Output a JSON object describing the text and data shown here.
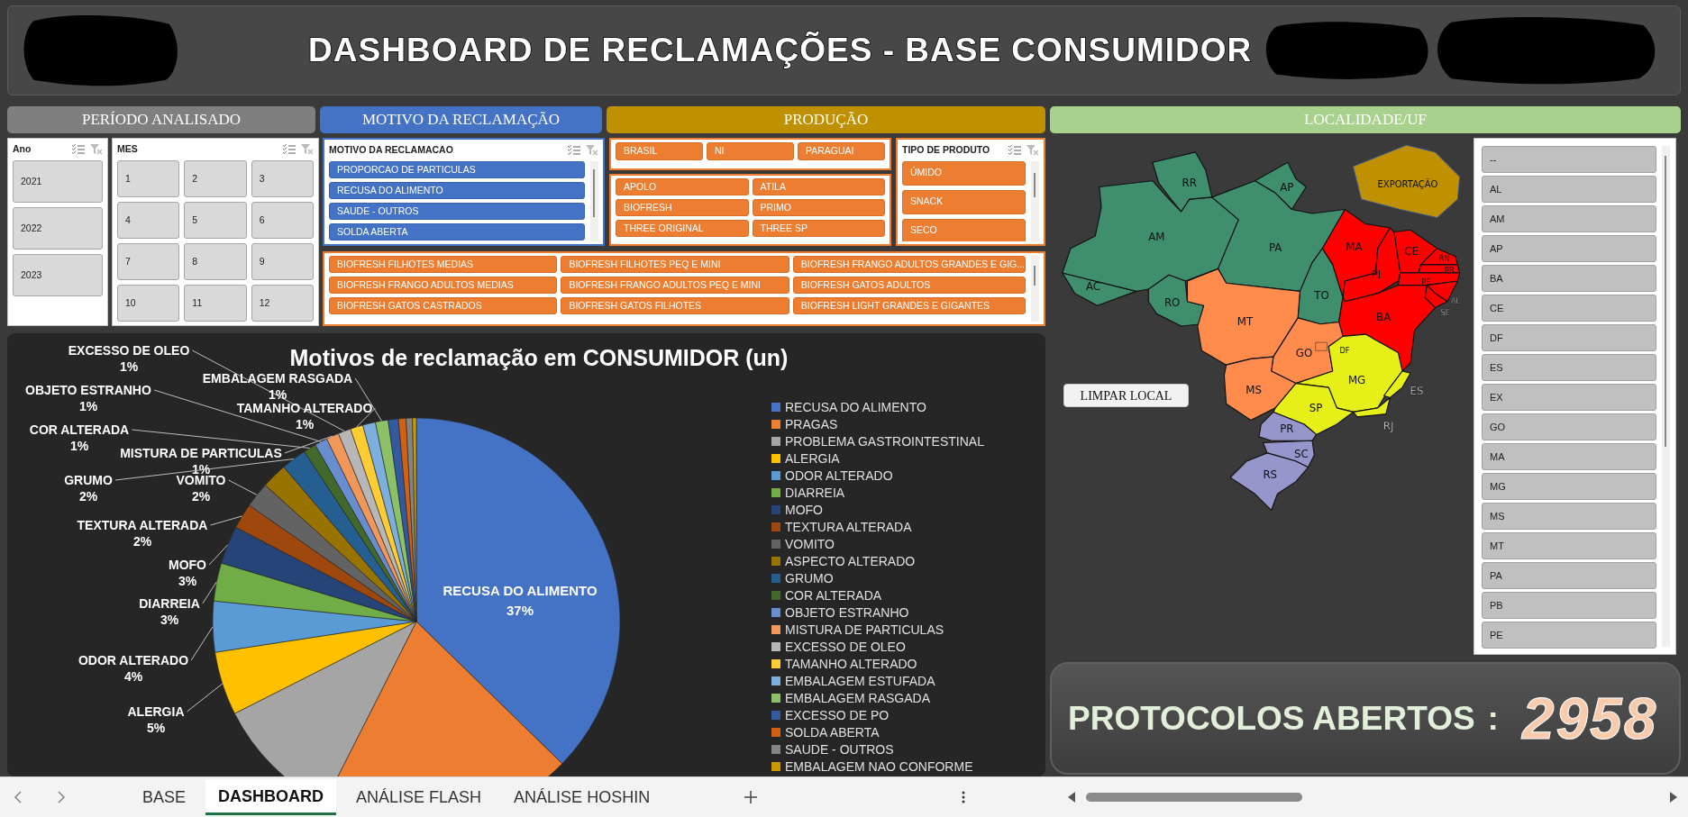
{
  "title": "DASHBOARD DE RECLAMAÇÕES - BASE CONSUMIDOR",
  "sections": [
    {
      "label": "PERÍODO ANALISADO",
      "color": "#7f7f7f"
    },
    {
      "label": "MOTIVO DA RECLAMAÇÃO",
      "color": "#4472c4"
    },
    {
      "label": "PRODUÇÃO",
      "color": "#bf9000"
    },
    {
      "label": "LOCALIDADE/UF",
      "color": "#a9d18e"
    }
  ],
  "slicers": {
    "year": {
      "title": "Ano",
      "items": [
        {
          "label": "2021",
          "selected": true
        },
        {
          "label": "2022",
          "selected": true
        },
        {
          "label": "2023",
          "selected": true
        }
      ]
    },
    "month": {
      "title": "MES",
      "items": [
        {
          "label": "1",
          "selected": true
        },
        {
          "label": "2",
          "selected": true
        },
        {
          "label": "3",
          "selected": true
        },
        {
          "label": "4",
          "selected": true
        },
        {
          "label": "5",
          "selected": true
        },
        {
          "label": "6",
          "selected": true
        },
        {
          "label": "7",
          "selected": true
        },
        {
          "label": "8",
          "selected": true
        },
        {
          "label": "9",
          "selected": true
        },
        {
          "label": "10",
          "selected": true
        },
        {
          "label": "11",
          "selected": true
        },
        {
          "label": "12",
          "selected": true
        }
      ]
    },
    "reason": {
      "title": "MOTIVO DA RECLAMACAO",
      "items": [
        {
          "label": "PROPORCAO DE PARTICULAS",
          "selected": true
        },
        {
          "label": "RECUSA DO ALIMENTO",
          "selected": true
        },
        {
          "label": "SAUDE - OUTROS",
          "selected": true
        },
        {
          "label": "SOLDA ABERTA",
          "selected": true
        }
      ]
    },
    "origin": {
      "items": [
        {
          "label": "BRASIL",
          "selected": true
        },
        {
          "label": "NI",
          "selected": true
        },
        {
          "label": "PARAGUAI",
          "selected": true
        }
      ]
    },
    "brand": {
      "items": [
        {
          "label": "APOLO",
          "selected": true
        },
        {
          "label": "ATILA",
          "selected": true
        },
        {
          "label": "BIOFRESH",
          "selected": true
        },
        {
          "label": "PRIMO",
          "selected": true
        },
        {
          "label": "THREE ORIGINAL",
          "selected": true
        },
        {
          "label": "THREE SP",
          "selected": true
        }
      ]
    },
    "product_type": {
      "title": "TIPO DE PRODUTO",
      "items": [
        {
          "label": "ÚMIDO",
          "selected": true
        },
        {
          "label": "SNACK",
          "selected": true
        },
        {
          "label": "SECO",
          "selected": true
        }
      ]
    },
    "product": {
      "items": [
        {
          "label": "BIOFRESH FILHOTES MEDIAS",
          "selected": true
        },
        {
          "label": "BIOFRESH FILHOTES PEQ E MINI",
          "selected": true
        },
        {
          "label": "BIOFRESH FRANGO ADULTOS GRANDES E GIG...",
          "selected": true
        },
        {
          "label": "BIOFRESH FRANGO ADULTOS MEDIAS",
          "selected": true
        },
        {
          "label": "BIOFRESH FRANGO ADULTOS PEQ E MINI",
          "selected": true
        },
        {
          "label": "BIOFRESH GATOS ADULTOS",
          "selected": true
        },
        {
          "label": "BIOFRESH GATOS CASTRADOS",
          "selected": true
        },
        {
          "label": "BIOFRESH GATOS FILHOTES",
          "selected": true
        },
        {
          "label": "BIOFRESH LIGHT GRANDES E GIGANTES",
          "selected": true
        }
      ]
    }
  },
  "chart": {
    "chart_data": {
      "type": "pie",
      "title": "Motivos de reclamação em CONSUMIDOR (un)",
      "categories": [
        "RECUSA DO ALIMENTO",
        "PRAGAS",
        "PROBLEMA GASTROINTESTINAL",
        "ALERGIA",
        "ODOR ALTERADO",
        "DIARREIA",
        "MOFO",
        "TEXTURA ALTERADA",
        "VOMITO",
        "ASPECTO ALTERADO",
        "GRUMO",
        "COR ALTERADA",
        "OBJETO ESTRANHO",
        "MISTURA DE PARTICULAS",
        "EXCESSO DE OLEO",
        "TAMANHO ALTERADO",
        "EMBALAGEM ESTUFADA",
        "EMBALAGEM RASGADA",
        "EXCESSO DE PO",
        "SOLDA ABERTA",
        "SAUDE - OUTROS",
        "EMBALAGEM NAO CONFORME"
      ],
      "values": [
        0.37,
        0.2,
        0.1,
        0.05,
        0.04,
        0.03,
        0.03,
        0.02,
        0.02,
        0.02,
        0.02,
        0.01,
        0.01,
        0.01,
        0.01,
        0.01,
        0.01,
        0.01,
        0.008,
        0.006,
        0.005,
        0.003
      ],
      "colors": [
        "#4472c4",
        "#ed7d31",
        "#a5a5a5",
        "#ffc000",
        "#5b9bd5",
        "#70ad47",
        "#264478",
        "#9e480e",
        "#636363",
        "#997300",
        "#255e91",
        "#43682b",
        "#698ed0",
        "#f1975a",
        "#b7b7b7",
        "#ffcd33",
        "#7cafdd",
        "#8cc168",
        "#335aa1",
        "#d26012",
        "#848484",
        "#cc9a00"
      ],
      "legend": "right"
    },
    "slice_labels": [
      {
        "text": "EXCESSO DE OLEO",
        "value": "1%"
      },
      {
        "text": "EMBALAGEM RASGADA",
        "value": "1%"
      },
      {
        "text": "OBJETO ESTRANHO",
        "value": "1%"
      },
      {
        "text": "TAMANHO ALTERADO",
        "value": "1%"
      },
      {
        "text": "COR ALTERADA",
        "value": "1%"
      },
      {
        "text": "MISTURA DE PARTICULAS",
        "value": "1%"
      },
      {
        "text": "GRUMO",
        "value": "2%"
      },
      {
        "text": "VOMITO",
        "value": "2%"
      },
      {
        "text": "TEXTURA ALTERADA",
        "value": "2%"
      },
      {
        "text": "MOFO",
        "value": "3%"
      },
      {
        "text": "DIARREIA",
        "value": "3%"
      },
      {
        "text": "RECUSA DO ALIMENTO",
        "value": "37%"
      },
      {
        "text": "ODOR ALTERADO",
        "value": "4%"
      },
      {
        "text": "ALERGIA",
        "value": "5%"
      }
    ]
  },
  "map": {
    "states": [
      {
        "label": "AC",
        "color": "#3f8f6f"
      },
      {
        "label": "AM",
        "color": "#3f8f6f"
      },
      {
        "label": "RR",
        "color": "#3f8f6f"
      },
      {
        "label": "AP",
        "color": "#3f8f6f"
      },
      {
        "label": "PA",
        "color": "#3f8f6f"
      },
      {
        "label": "RO",
        "color": "#3f8f6f"
      },
      {
        "label": "TO",
        "color": "#3f8f6f"
      },
      {
        "label": "MA",
        "color": "#ff0000"
      },
      {
        "label": "PI",
        "color": "#ff0000"
      },
      {
        "label": "CE",
        "color": "#ff0000"
      },
      {
        "label": "RN",
        "color": "#ff0000"
      },
      {
        "label": "PB",
        "color": "#ff0000"
      },
      {
        "label": "PE",
        "color": "#ff0000"
      },
      {
        "label": "AL",
        "color": "#ff0000"
      },
      {
        "label": "SE",
        "color": "#ff0000"
      },
      {
        "label": "BA",
        "color": "#ff0000"
      },
      {
        "label": "MT",
        "color": "#ff8c4c"
      },
      {
        "label": "GO",
        "color": "#ff8c4c"
      },
      {
        "label": "DF",
        "color": "#ff8c4c"
      },
      {
        "label": "MS",
        "color": "#ff8c4c"
      },
      {
        "label": "MG",
        "color": "#e6ef18"
      },
      {
        "label": "ES",
        "color": "#e6ef18"
      },
      {
        "label": "RJ",
        "color": "#e6ef18"
      },
      {
        "label": "SP",
        "color": "#e6ef18"
      },
      {
        "label": "PR",
        "color": "#9696cc"
      },
      {
        "label": "SC",
        "color": "#9696cc"
      },
      {
        "label": "RS",
        "color": "#9696cc"
      }
    ],
    "export_label": "EXPORTAÇÃO",
    "clear_button": "LIMPAR LOCAL"
  },
  "uf_slicer": {
    "items": [
      {
        "label": "--",
        "selected": true
      },
      {
        "label": "AL",
        "selected": true
      },
      {
        "label": "AM",
        "selected": true
      },
      {
        "label": "AP",
        "selected": true
      },
      {
        "label": "BA",
        "selected": true
      },
      {
        "label": "CE",
        "selected": true
      },
      {
        "label": "DF",
        "selected": true
      },
      {
        "label": "ES",
        "selected": true
      },
      {
        "label": "EX",
        "selected": true
      },
      {
        "label": "GO",
        "selected": true
      },
      {
        "label": "MA",
        "selected": true
      },
      {
        "label": "MG",
        "selected": true
      },
      {
        "label": "MS",
        "selected": true
      },
      {
        "label": "MT",
        "selected": true
      },
      {
        "label": "PA",
        "selected": true
      },
      {
        "label": "PB",
        "selected": true
      },
      {
        "label": "PE",
        "selected": true
      }
    ]
  },
  "protocols": {
    "label": "PROTOCOLOS ABERTOS",
    "separator": ":",
    "value": "2958"
  },
  "sheet_tabs": [
    {
      "label": "BASE",
      "selected": false
    },
    {
      "label": "DASHBOARD",
      "selected": true
    },
    {
      "label": "ANÁLISE FLASH",
      "selected": false
    },
    {
      "label": "ANÁLISE HOSHIN",
      "selected": false
    }
  ]
}
